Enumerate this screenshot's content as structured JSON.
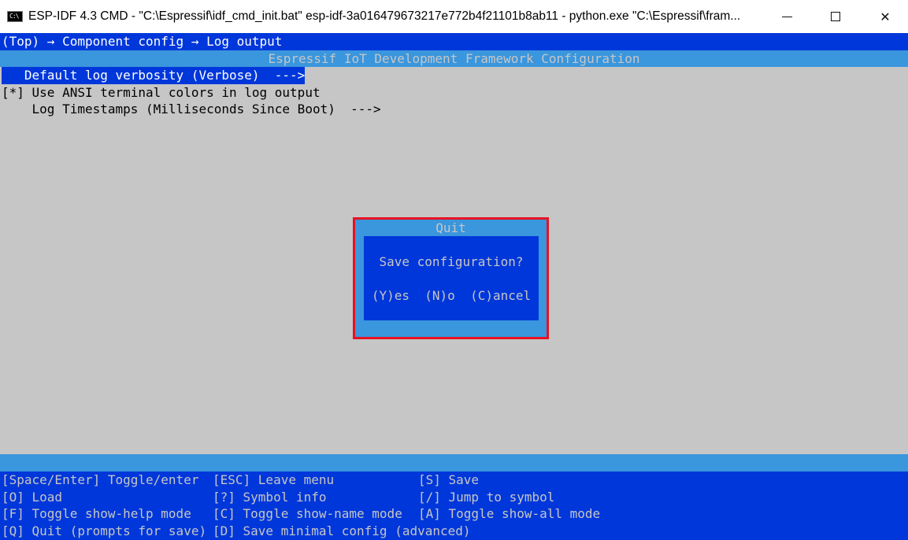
{
  "window": {
    "icon_text": "C:\\",
    "title": "ESP-IDF 4.3 CMD - \"C:\\Espressif\\idf_cmd_init.bat\"  esp-idf-3a016479673217e772b4f21101b8ab11 - python.exe  \"C:\\Espressif\\fram...",
    "close_glyph": "✕"
  },
  "terminal": {
    "breadcrumb": "(Top) → Component config → Log output",
    "framework_title": "Espressif IoT Development Framework Configuration",
    "menu": {
      "selected": "   Default log verbosity (Verbose)  --->",
      "ansi_colors": "[*] Use ANSI terminal colors in log output",
      "timestamps": "    Log Timestamps (Milliseconds Since Boot)  --->"
    },
    "dialog": {
      "title": "Quit",
      "question": "Save configuration?",
      "yes": "(Y)es",
      "no": "(N)o",
      "cancel": "(C)ancel"
    },
    "help": {
      "space_enter": "[Space/Enter] Toggle/enter",
      "esc": "[ESC] Leave menu",
      "save": "[S] Save",
      "load": "[O] Load",
      "symbol_info": "[?] Symbol info",
      "jump": "[/] Jump to symbol",
      "help_mode": "[F] Toggle show-help mode",
      "name_mode": "[C] Toggle show-name mode",
      "all_mode": "[A] Toggle show-all mode",
      "quit": "[Q] Quit (prompts for save)",
      "minimal": "[D] Save minimal config (advanced)"
    }
  },
  "colors": {
    "terminal_bg": "#c6c6c6",
    "blue": "#0037da",
    "light_blue": "#3a96dd",
    "highlight_red": "#e81123"
  }
}
